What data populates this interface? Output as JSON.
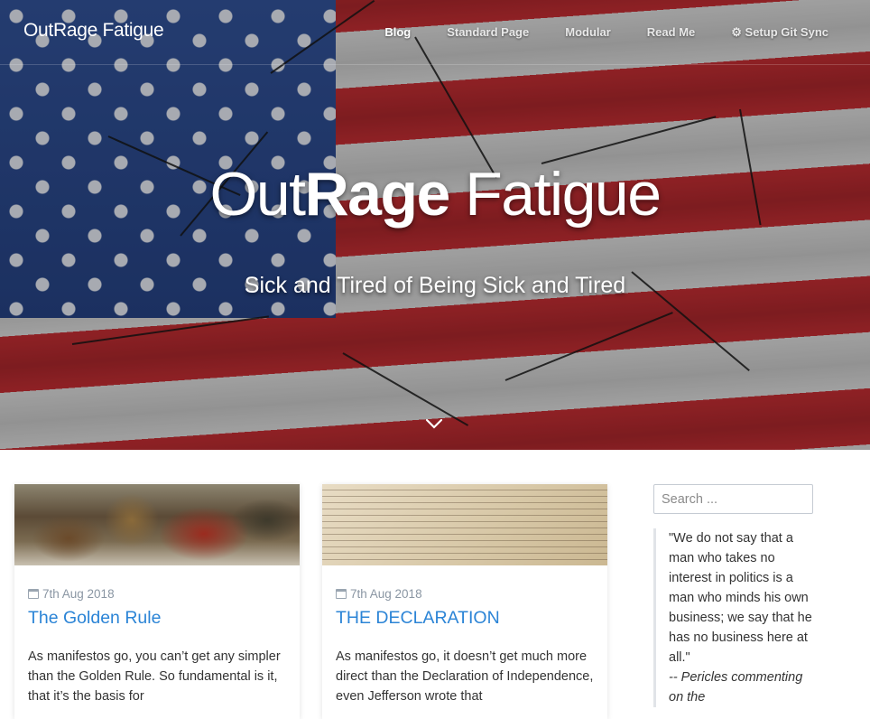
{
  "site": {
    "brand": "OutRage Fatigue",
    "nav": [
      {
        "label": "Blog",
        "active": true
      },
      {
        "label": "Standard Page"
      },
      {
        "label": "Modular"
      },
      {
        "label": "Read Me"
      },
      {
        "label": "⚙ Setup Git Sync"
      }
    ]
  },
  "hero": {
    "title_part1": "Out",
    "title_part2": "Rage",
    "title_part3": " Fatigue",
    "subtitle": "Sick and Tired of Being Sick and Tired",
    "scroll_icon": "chevron-down-icon"
  },
  "posts": [
    {
      "date": "7th Aug 2018",
      "title": "The Golden Rule",
      "excerpt": "As manifestos go, you can’t get any simpler than the Golden Rule. So fundamental is it, that it’s the basis for"
    },
    {
      "date": "7th Aug 2018",
      "title": "THE DECLARATION",
      "excerpt": "As manifestos go, it doesn’t get much more direct than the Declaration of Independence, even Jefferson wrote that"
    }
  ],
  "sidebar": {
    "search_placeholder": "Search ...",
    "quote_text": "\"We do not say that a man who takes no interest in politics is a man who minds his own business; we say that he has no business here at all.\"",
    "quote_attr": "-- Pericles commenting on the"
  },
  "colors": {
    "link": "#2b84d6",
    "meta": "#8a96a3"
  }
}
